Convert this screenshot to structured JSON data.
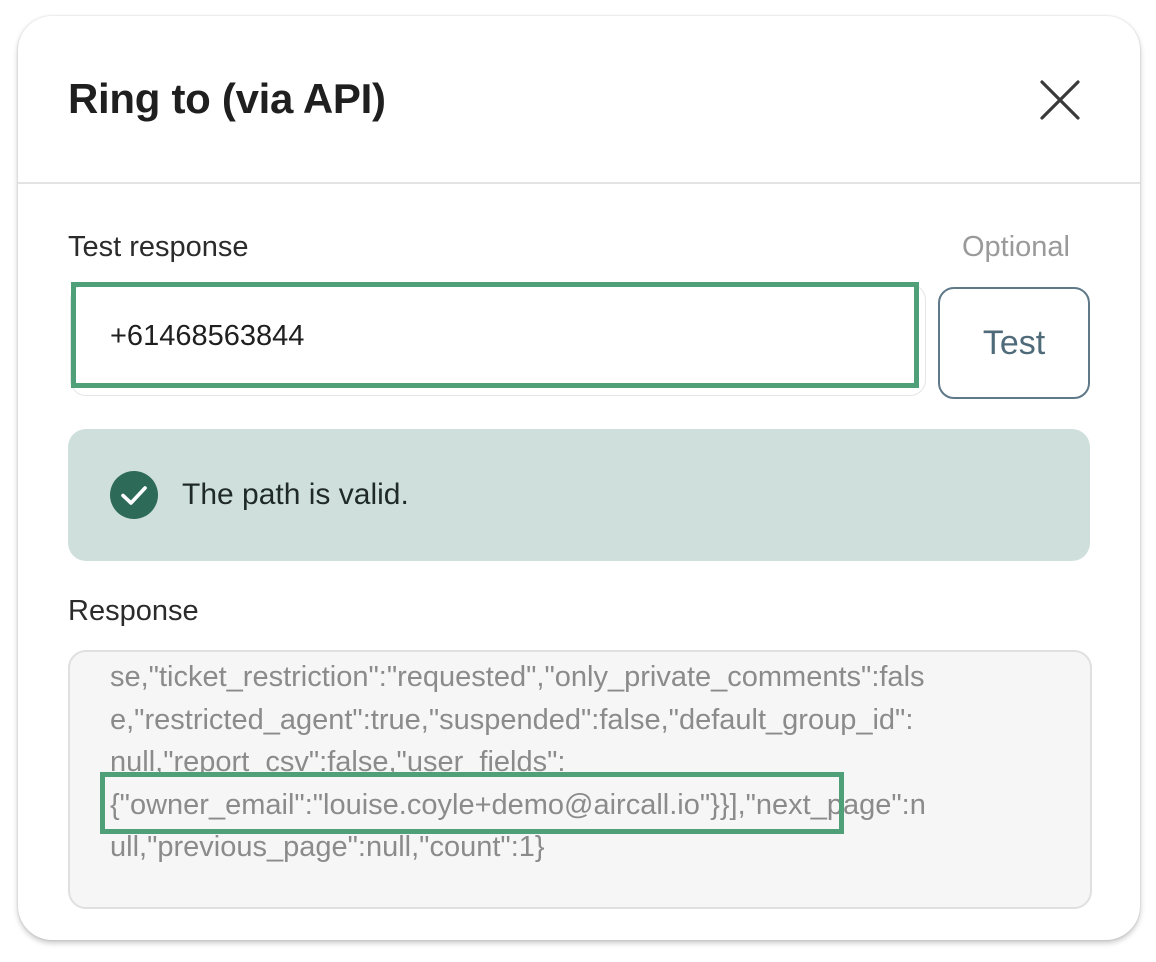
{
  "dialog": {
    "title": "Ring to (via API)"
  },
  "test_response": {
    "label": "Test response",
    "optional_label": "Optional",
    "value": "+61468563844",
    "button_label": "Test"
  },
  "status": {
    "message": "The path is valid.",
    "icon": "check-circle-icon",
    "banner_color": "#cfe0dc",
    "icon_color": "#2e6a58"
  },
  "response": {
    "label": "Response",
    "lines": [
      "se,\"ticket_restriction\":\"requested\",\"only_private_comments\":fals",
      "e,\"restricted_agent\":true,\"suspended\":false,\"default_group_id\":",
      "null,\"report_csv\":false,\"user_fields\":",
      "{\"owner_email\":\"louise.coyle+demo@aircall.io\"}}],\"next_page\":n",
      "ull,\"previous_page\":null,\"count\":1}"
    ]
  },
  "colors": {
    "highlight": "#4fa078",
    "button_border": "#5f7988"
  }
}
